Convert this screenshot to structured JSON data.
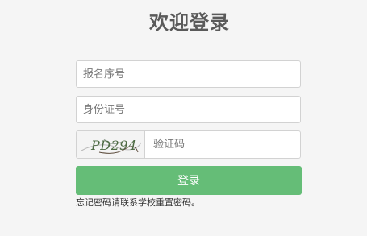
{
  "login": {
    "title": "欢迎登录",
    "registration_number_placeholder": "报名序号",
    "id_number_placeholder": "身份证号",
    "captcha_image_text": "PD294",
    "captcha_placeholder": "验证码",
    "submit_label": "登录",
    "hint": "忘记密码请联系学校重置密码。"
  },
  "colors": {
    "background": "#f5f5f5",
    "button": "#65bd77",
    "title": "#5a5a5a"
  }
}
